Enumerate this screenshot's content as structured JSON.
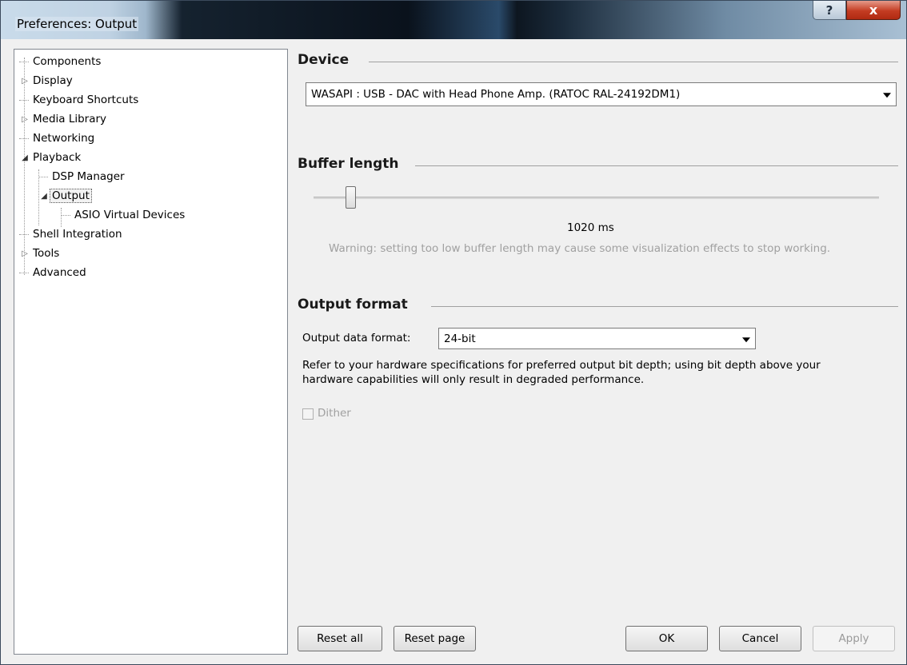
{
  "window": {
    "title": "Preferences: Output",
    "help_glyph": "?",
    "close_glyph": "x"
  },
  "tree": {
    "items": [
      {
        "label": "Components"
      },
      {
        "label": "Display"
      },
      {
        "label": "Keyboard Shortcuts"
      },
      {
        "label": "Media Library"
      },
      {
        "label": "Networking"
      },
      {
        "label": "Playback"
      },
      {
        "label": "DSP Manager"
      },
      {
        "label": "Output"
      },
      {
        "label": "ASIO Virtual Devices"
      },
      {
        "label": "Shell Integration"
      },
      {
        "label": "Tools"
      },
      {
        "label": "Advanced"
      }
    ],
    "selected": "Output",
    "collapsed_glyph": "▷",
    "expanded_glyph": "◢"
  },
  "device": {
    "title": "Device",
    "selected": "WASAPI : USB - DAC with Head Phone Amp. (RATOC RAL-24192DM1)"
  },
  "buffer": {
    "title": "Buffer length",
    "value_label": "1020 ms",
    "slider_fraction": 0.065,
    "warning": "Warning: setting too low buffer length may cause some visualization effects to stop working."
  },
  "output_format": {
    "title": "Output format",
    "label": "Output data format:",
    "selected": "24-bit",
    "note_line1": "Refer to your hardware specifications for preferred output bit depth; using bit depth above your",
    "note_line2": "hardware capabilities will only result in degraded performance.",
    "dither_label": "Dither",
    "dither_checked": false
  },
  "buttons": {
    "reset_all": "Reset all",
    "reset_page": "Reset page",
    "ok": "OK",
    "cancel": "Cancel",
    "apply": "Apply"
  }
}
